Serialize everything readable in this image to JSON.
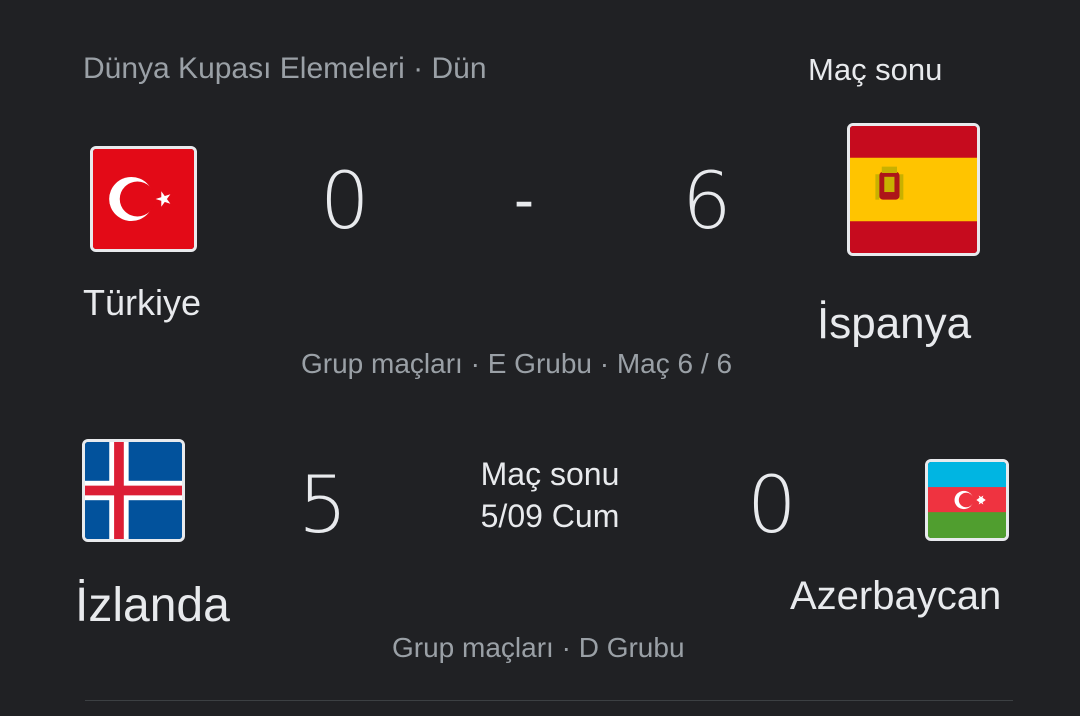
{
  "match1": {
    "competition_line": "Dünya Kupası Elemeleri · Dün",
    "status": "Maç sonu",
    "home": {
      "name": "Türkiye",
      "score": "0",
      "flag_icon": "turkey-flag-icon"
    },
    "away": {
      "name": "İspanya",
      "score": "6",
      "flag_icon": "spain-flag-icon"
    },
    "separator": "-",
    "group_info": "Grup maçları · E Grubu · Maç 6 / 6"
  },
  "match2": {
    "status": "Maç sonu",
    "date": "5/09 Cum",
    "home": {
      "name": "İzlanda",
      "score": "5",
      "flag_icon": "iceland-flag-icon"
    },
    "away": {
      "name": "Azerbaycan",
      "score": "0",
      "flag_icon": "azerbaijan-flag-icon"
    },
    "group_info": "Grup maçları · D Grubu"
  },
  "colors": {
    "background": "#202124",
    "primary_text": "#e8eaed",
    "secondary_text": "#9aa0a6"
  }
}
